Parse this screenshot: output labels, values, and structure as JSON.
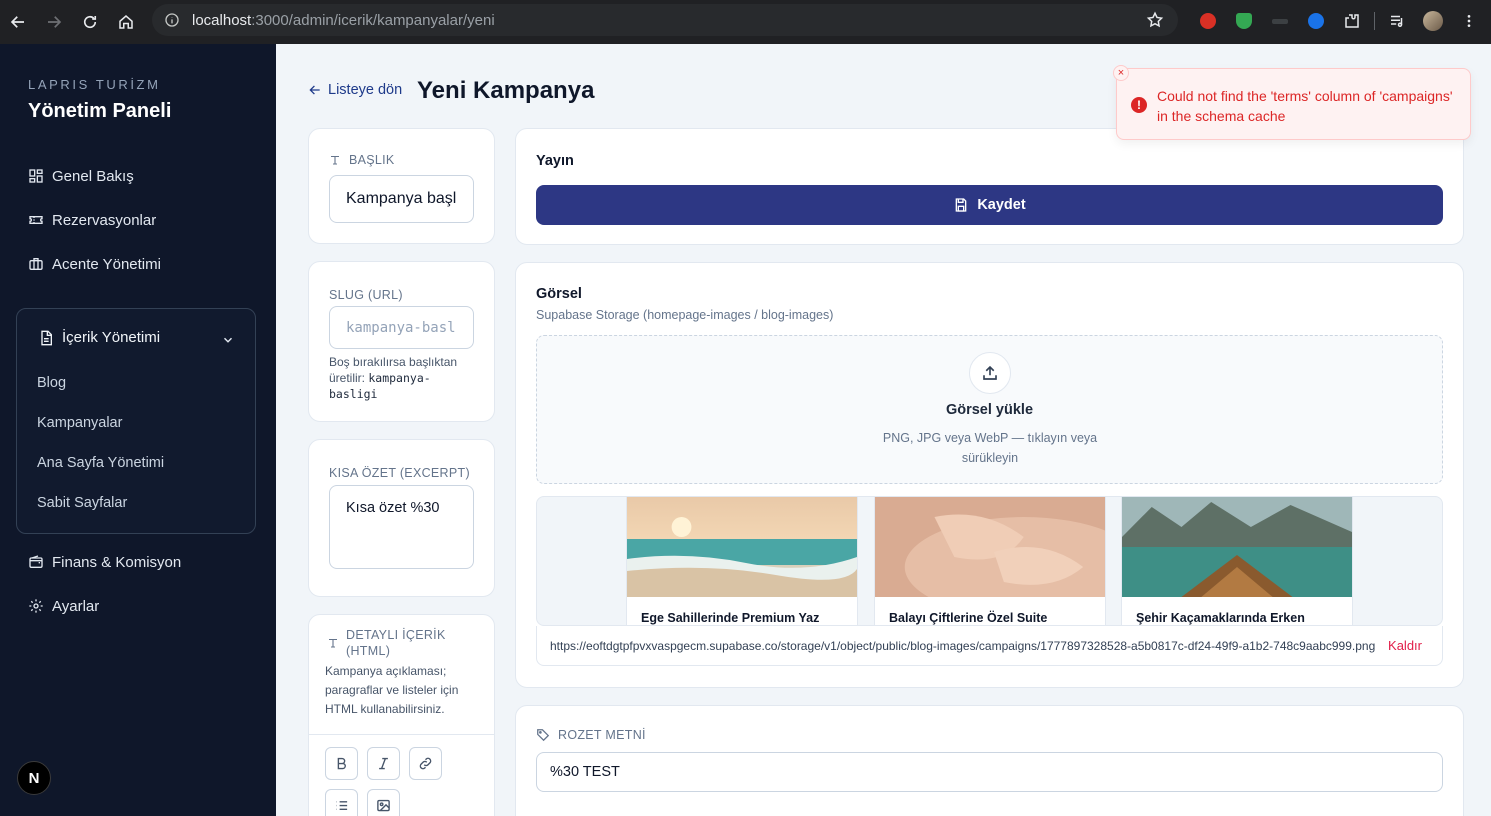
{
  "browser": {
    "url_host": "localhost",
    "url_path": ":3000/admin/icerik/kampanyalar/yeni"
  },
  "sidebar": {
    "brand_small": "LAPRIS TURİZM",
    "brand_title": "Yönetim Paneli",
    "items": [
      {
        "label": "Genel Bakış",
        "icon": "dashboard-icon"
      },
      {
        "label": "Rezervasyonlar",
        "icon": "ticket-icon"
      },
      {
        "label": "Acente Yönetimi",
        "icon": "briefcase-icon"
      }
    ],
    "group": {
      "label": "İçerik Yönetimi",
      "icon": "document-icon",
      "subitems": [
        "Blog",
        "Kampanyalar",
        "Ana Sayfa Yönetimi",
        "Sabit Sayfalar"
      ]
    },
    "bottom_items": [
      {
        "label": "Finans & Komisyon",
        "icon": "wallet-icon"
      },
      {
        "label": "Ayarlar",
        "icon": "gear-icon"
      }
    ],
    "next_badge": "N"
  },
  "header": {
    "back_label": "Listeye dön",
    "title": "Yeni Kampanya"
  },
  "form": {
    "title_label": "BAŞLIK",
    "title_value": "Kampanya başl",
    "slug_label": "SLUG (URL)",
    "slug_placeholder": "kampanya-basl",
    "slug_help": "Boş bırakılırsa başlıktan üretilir:",
    "slug_example": "kampanya-basligi",
    "excerpt_label": "KISA ÖZET (EXCERPT)",
    "excerpt_value": "Kısa özet %30",
    "content_label": "DETAYLI İÇERİK (HTML)",
    "content_help": "Kampanya açıklaması; paragraflar ve listeler için HTML kullanabilirsiniz."
  },
  "publish": {
    "title": "Yayın",
    "save_label": "Kaydet"
  },
  "image": {
    "title": "Görsel",
    "subtitle": "Supabase Storage (homepage-images / blog-images)",
    "upload_title": "Görsel yükle",
    "upload_help": "PNG, JPG veya WebP — tıklayın veya sürükleyin",
    "previews": [
      {
        "title": "Ege Sahillerinde Premium Yaz"
      },
      {
        "title": "Balayı Çiftlerine Özel Suite"
      },
      {
        "title": "Şehir Kaçamaklarında Erken"
      }
    ],
    "url": "https://eoftdgtpfpvxvaspgecm.supabase.co/storage/v1/object/public/blog-images/campaigns/1777897328528-a5b0817c-df24-49f9-a1b2-748c9aabc999.png",
    "remove_label": "Kaldır"
  },
  "badge": {
    "label": "ROZET METNİ",
    "value": "%30 TEST"
  },
  "toast": {
    "message": "Could not find the 'terms' column of 'campaigns' in the schema cache",
    "close": "×"
  },
  "colors": {
    "sidebar_bg": "#0f172a",
    "primary": "#2d3784",
    "danger": "#dc2626"
  }
}
